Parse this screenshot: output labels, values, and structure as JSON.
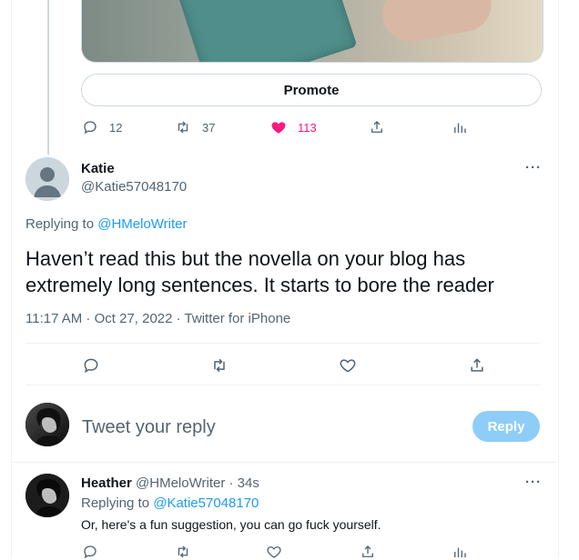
{
  "top_tweet": {
    "promote_label": "Promote",
    "stats": {
      "replies": "12",
      "retweets": "37",
      "likes": "113"
    }
  },
  "focused_tweet": {
    "author_name": "Katie",
    "author_handle": "@Katie57048170",
    "replying_prefix": "Replying to ",
    "replying_to": "@HMeloWriter",
    "text": "Haven’t read this but the novella on your blog has extremely long sentences. It starts to bore the reader",
    "meta": "11:17 AM · Oct 27, 2022 · Twitter for iPhone"
  },
  "reply_box": {
    "placeholder": "Tweet your reply",
    "button_label": "Reply"
  },
  "reply_tweet": {
    "author_name": "Heather",
    "author_handle": "@HMeloWriter",
    "time": " · 34s",
    "replying_prefix": "Replying to ",
    "replying_to": "@Katie57048170",
    "text": "Or, here's a fun suggestion, you can go fuck yourself."
  },
  "colors": {
    "accent": "#1d9bf0",
    "like": "#f91880",
    "muted": "#536471"
  }
}
